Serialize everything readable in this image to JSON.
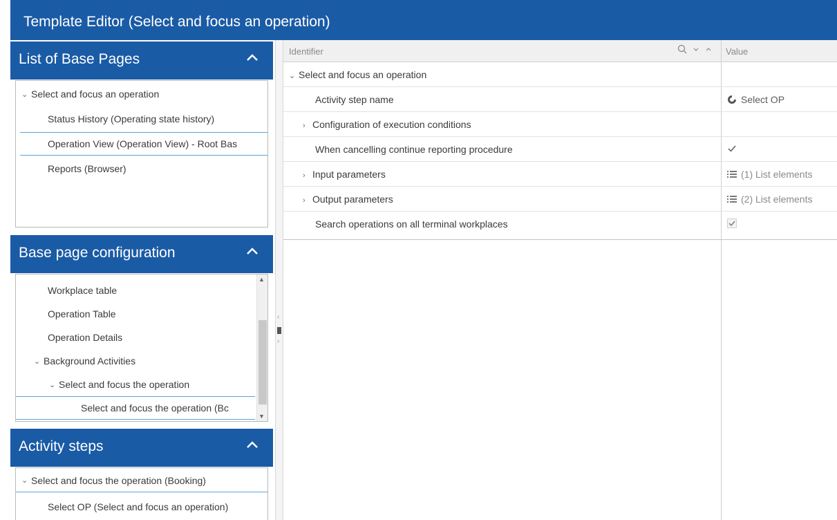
{
  "window": {
    "title": "Template Editor (Select and focus an operation)"
  },
  "panels": {
    "base_pages": {
      "title": "List of Base Pages",
      "items": [
        {
          "label": "Select and focus an operation",
          "indent": 0,
          "expanded": true
        },
        {
          "label": "Status History (Operating state history)",
          "indent": 1
        },
        {
          "label": "Operation View (Operation View) - Root Bas",
          "indent": 1,
          "selected": true
        },
        {
          "label": "Reports (Browser)",
          "indent": 1
        }
      ]
    },
    "base_config": {
      "title": "Base page configuration",
      "items": [
        {
          "label": "Workplace table",
          "indent": 1
        },
        {
          "label": "Operation Table",
          "indent": 1
        },
        {
          "label": "Operation Details",
          "indent": 1
        },
        {
          "label": "Background Activities",
          "indent": 1,
          "expanded": true
        },
        {
          "label": "Select and focus the operation",
          "indent": 2,
          "expanded": true
        },
        {
          "label": "Select and focus the operation (Bc",
          "indent": 3,
          "selected": true
        }
      ]
    },
    "activity_steps": {
      "title": "Activity steps",
      "items": [
        {
          "label": "Select and focus the operation (Booking)",
          "indent": 0,
          "expanded": true
        },
        {
          "label": "Select OP (Select and focus an operation)",
          "indent": 1
        }
      ]
    }
  },
  "grid": {
    "columns": {
      "identifier": "Identifier",
      "value": "Value"
    },
    "rows": [
      {
        "name": "Select and focus an operation",
        "toggle": "expanded",
        "value": ""
      },
      {
        "name": "Activity step name",
        "value": "Select OP",
        "value_icon": "globe-icon"
      },
      {
        "name": "Configuration of execution conditions",
        "toggle": "collapsed",
        "value": ""
      },
      {
        "name": "When cancelling continue reporting procedure",
        "value_check": true
      },
      {
        "name": "Input parameters",
        "toggle": "collapsed",
        "value": "(1) List elements",
        "value_icon": "list-icon"
      },
      {
        "name": "Output parameters",
        "toggle": "collapsed",
        "value": "(2) List elements",
        "value_icon": "list-icon"
      },
      {
        "name": "Search operations on all terminal workplaces",
        "value_check": true
      }
    ]
  },
  "colors": {
    "accent": "#1a5ba6",
    "selection_line": "#5aa3d6"
  }
}
